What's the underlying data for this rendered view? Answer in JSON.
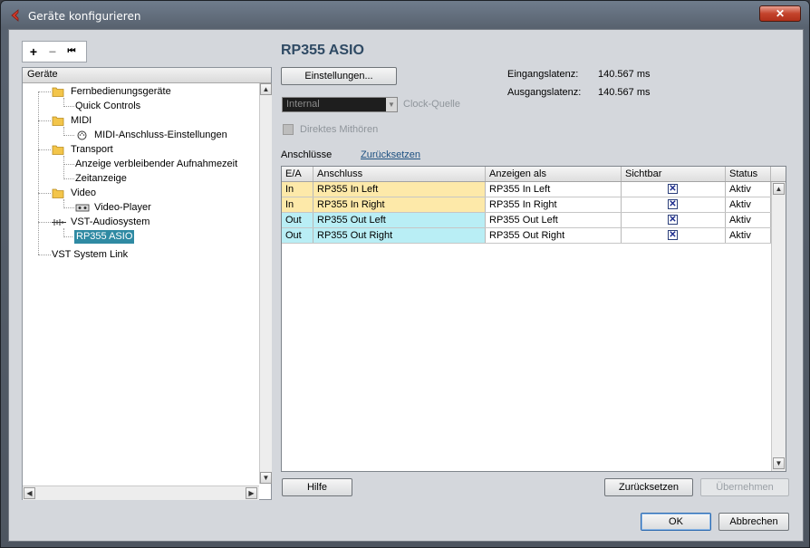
{
  "window": {
    "title": "Geräte konfigurieren",
    "close_label": "✕"
  },
  "toolbar": {
    "add": "+",
    "remove": "−",
    "reset": "⏮"
  },
  "tree": {
    "header": "Geräte",
    "items": [
      {
        "label": "Fernbedienungsgeräte"
      },
      {
        "label": "Quick Controls"
      },
      {
        "label": "MIDI"
      },
      {
        "label": "MIDI-Anschluss-Einstellungen"
      },
      {
        "label": "Transport"
      },
      {
        "label": "Anzeige verbleibender Aufnahmezeit"
      },
      {
        "label": "Zeitanzeige"
      },
      {
        "label": "Video"
      },
      {
        "label": "Video-Player"
      },
      {
        "label": "VST-Audiosystem"
      },
      {
        "label": "RP355 ASIO"
      },
      {
        "label": "VST System Link"
      }
    ]
  },
  "panel": {
    "title": "RP355 ASIO",
    "settings_button": "Einstellungen...",
    "input_latency_label": "Eingangslatenz:",
    "input_latency_value": "140.567 ms",
    "output_latency_label": "Ausgangslatenz:",
    "output_latency_value": "140.567 ms",
    "clock_value": "Internal",
    "clock_label": "Clock-Quelle",
    "monitor_label": "Direktes Mithören",
    "ports_label": "Anschlüsse",
    "reset_link": "Zurücksetzen"
  },
  "table": {
    "headers": [
      "E/A",
      "Anschluss",
      "Anzeigen als",
      "Sichtbar",
      "Status"
    ],
    "rows": [
      {
        "io": "In",
        "port": "RP355 In Left",
        "display": "RP355 In Left",
        "visible": "✕",
        "status": "Aktiv"
      },
      {
        "io": "In",
        "port": "RP355 In Right",
        "display": "RP355 In Right",
        "visible": "✕",
        "status": "Aktiv"
      },
      {
        "io": "Out",
        "port": "RP355 Out Left",
        "display": "RP355 Out Left",
        "visible": "✕",
        "status": "Aktiv"
      },
      {
        "io": "Out",
        "port": "RP355 Out Right",
        "display": "RP355 Out Right",
        "visible": "✕",
        "status": "Aktiv"
      }
    ]
  },
  "buttons": {
    "help": "Hilfe",
    "reset": "Zurücksetzen",
    "apply": "Übernehmen",
    "ok": "OK",
    "cancel": "Abbrechen"
  },
  "colors": {
    "in_row": "#fde9a9",
    "out_row": "#b9eef5",
    "selection": "#2f8aa3",
    "title": "#2f4a64"
  }
}
